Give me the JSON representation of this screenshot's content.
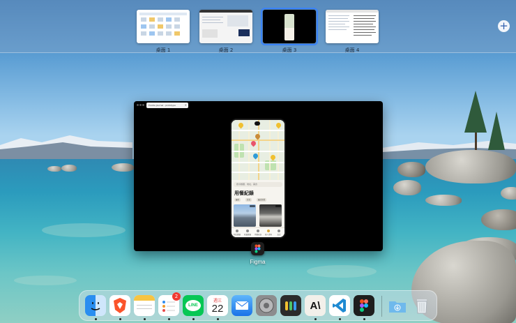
{
  "spaces": [
    {
      "label": "桌面 1",
      "active": false
    },
    {
      "label": "桌面 2",
      "active": false
    },
    {
      "label": "桌面 3",
      "active": true
    },
    {
      "label": "桌面 4",
      "active": false
    }
  ],
  "add_space": {
    "label": "+"
  },
  "window": {
    "app_name": "Figma",
    "tab_title": "Foodie Journal - prototype",
    "tab_close": "×",
    "phone": {
      "search_placeholder": "搜尋餐廳、地址、美食",
      "heading": "用餐紀錄",
      "chips": [
        "最新",
        "台北",
        "最近新增"
      ],
      "tabbar": [
        "附近餐廳",
        "收藏餐廳",
        "用餐紀錄",
        "個人資料",
        "設定"
      ]
    }
  },
  "dock": {
    "items": [
      {
        "name": "finder",
        "icon": "finder-icon",
        "running": true
      },
      {
        "name": "brave",
        "icon": "brave-icon",
        "running": true
      },
      {
        "name": "notes",
        "icon": "notes-icon",
        "running": true
      },
      {
        "name": "reminders",
        "icon": "reminders-icon",
        "running": true,
        "badge": "2"
      },
      {
        "name": "line",
        "icon": "line-icon",
        "running": true,
        "text": "LINE"
      },
      {
        "name": "calendar",
        "icon": "calendar-icon",
        "running": true,
        "weekday": "週三",
        "day": "22"
      },
      {
        "name": "mail",
        "icon": "mail-icon",
        "running": false
      },
      {
        "name": "system-settings",
        "icon": "gear-icon",
        "running": false
      },
      {
        "name": "keychain-access",
        "icon": "keys-icon",
        "running": false
      },
      {
        "name": "anthropic-claude",
        "icon": "anthropic-icon",
        "running": true,
        "text": "A\\"
      },
      {
        "name": "vscode",
        "icon": "vscode-icon",
        "running": true
      },
      {
        "name": "figma",
        "icon": "figma-icon",
        "running": true
      },
      {
        "name": "downloads",
        "icon": "downloads-folder-icon",
        "running": false
      },
      {
        "name": "trash",
        "icon": "trash-icon",
        "running": false
      }
    ]
  },
  "colors": {
    "accent": "#3a82f7",
    "badge": "#f13a32"
  }
}
